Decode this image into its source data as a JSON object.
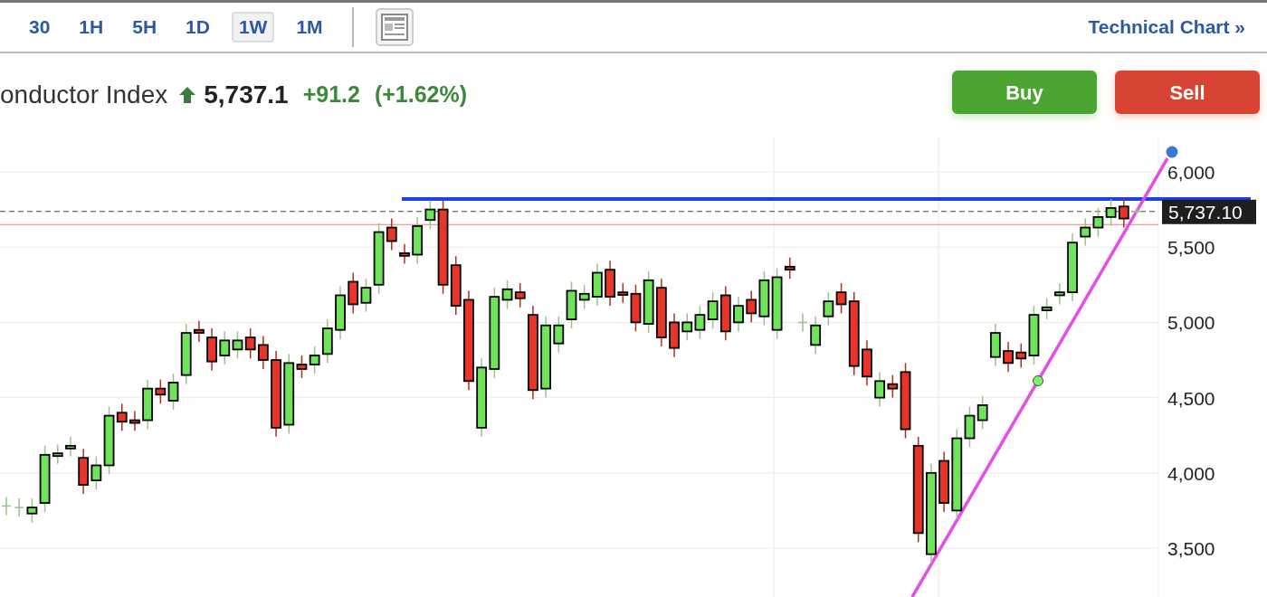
{
  "timeframes": [
    {
      "label": "30",
      "selected": false
    },
    {
      "label": "1H",
      "selected": false
    },
    {
      "label": "5H",
      "selected": false
    },
    {
      "label": "1D",
      "selected": false
    },
    {
      "label": "1W",
      "selected": true
    },
    {
      "label": "1M",
      "selected": false
    }
  ],
  "technical_link": {
    "label": "Technical Chart",
    "chevron": "»"
  },
  "quote": {
    "name": "onductor Index",
    "price": "5,737.1",
    "change": "+91.2",
    "change_pct": "(+1.62%)"
  },
  "buttons": [
    {
      "kind": "buy",
      "label": "Buy"
    },
    {
      "kind": "sell",
      "label": "Sell"
    }
  ],
  "chart": {
    "current_price": "5,737.10",
    "chart_data": {
      "type": "candlestick",
      "grid": true,
      "ylim": [
        3500,
        6000
      ],
      "ohlc": [
        [
          3780,
          3840,
          3720,
          3780
        ],
        [
          3770,
          3830,
          3710,
          3770
        ],
        [
          3730,
          3830,
          3670,
          3770
        ],
        [
          3800,
          4180,
          3740,
          4120
        ],
        [
          4120,
          4190,
          4060,
          4130
        ],
        [
          4170,
          4240,
          4110,
          4180
        ],
        [
          4100,
          4160,
          3860,
          3920
        ],
        [
          3950,
          4110,
          3890,
          4050
        ],
        [
          4050,
          4440,
          3990,
          4380
        ],
        [
          4400,
          4460,
          4280,
          4340
        ],
        [
          4350,
          4410,
          4280,
          4340
        ],
        [
          4350,
          4620,
          4290,
          4560
        ],
        [
          4560,
          4620,
          4460,
          4520
        ],
        [
          4480,
          4660,
          4420,
          4600
        ],
        [
          4650,
          4990,
          4590,
          4930
        ],
        [
          4950,
          5010,
          4870,
          4930
        ],
        [
          4900,
          4960,
          4680,
          4740
        ],
        [
          4780,
          4940,
          4720,
          4880
        ],
        [
          4820,
          4940,
          4760,
          4880
        ],
        [
          4900,
          4960,
          4760,
          4820
        ],
        [
          4850,
          4910,
          4690,
          4750
        ],
        [
          4750,
          4810,
          4240,
          4300
        ],
        [
          4320,
          4790,
          4260,
          4730
        ],
        [
          4720,
          4780,
          4630,
          4690
        ],
        [
          4720,
          4840,
          4660,
          4780
        ],
        [
          4790,
          5020,
          4730,
          4960
        ],
        [
          4950,
          5240,
          4890,
          5180
        ],
        [
          5270,
          5330,
          5060,
          5120
        ],
        [
          5130,
          5290,
          5070,
          5230
        ],
        [
          5250,
          5660,
          5190,
          5600
        ],
        [
          5630,
          5690,
          5480,
          5540
        ],
        [
          5460,
          5520,
          5390,
          5450
        ],
        [
          5450,
          5700,
          5390,
          5640
        ],
        [
          5680,
          5810,
          5620,
          5750
        ],
        [
          5750,
          5810,
          5190,
          5250
        ],
        [
          5380,
          5440,
          5050,
          5110
        ],
        [
          5150,
          5210,
          4550,
          4610
        ],
        [
          4300,
          4760,
          4240,
          4700
        ],
        [
          4690,
          5230,
          4630,
          5170
        ],
        [
          5150,
          5280,
          5090,
          5220
        ],
        [
          5200,
          5260,
          5100,
          5160
        ],
        [
          5050,
          5110,
          4490,
          4550
        ],
        [
          4560,
          5040,
          4500,
          4980
        ],
        [
          4860,
          5040,
          4800,
          4980
        ],
        [
          5020,
          5270,
          4960,
          5210
        ],
        [
          5150,
          5250,
          5090,
          5190
        ],
        [
          5170,
          5390,
          5110,
          5330
        ],
        [
          5350,
          5410,
          5110,
          5170
        ],
        [
          5200,
          5260,
          5130,
          5190
        ],
        [
          5190,
          5250,
          4940,
          5000
        ],
        [
          4990,
          5340,
          4930,
          5280
        ],
        [
          5230,
          5290,
          4840,
          4900
        ],
        [
          5000,
          5060,
          4770,
          4830
        ],
        [
          4940,
          5060,
          4880,
          5000
        ],
        [
          4950,
          5110,
          4890,
          5050
        ],
        [
          5020,
          5200,
          4960,
          5140
        ],
        [
          5180,
          5240,
          4880,
          4940
        ],
        [
          5000,
          5170,
          4940,
          5110
        ],
        [
          5150,
          5210,
          5000,
          5060
        ],
        [
          5040,
          5340,
          4980,
          5280
        ],
        [
          4950,
          5360,
          4890,
          5300
        ],
        [
          5370,
          5430,
          5290,
          5350
        ],
        [
          5000,
          5060,
          4940,
          5000
        ],
        [
          4850,
          5040,
          4790,
          4980
        ],
        [
          5040,
          5200,
          4980,
          5140
        ],
        [
          5200,
          5260,
          5060,
          5120
        ],
        [
          5140,
          5200,
          4650,
          4710
        ],
        [
          4820,
          4880,
          4580,
          4640
        ],
        [
          4500,
          4670,
          4440,
          4610
        ],
        [
          4590,
          4650,
          4500,
          4560
        ],
        [
          4670,
          4730,
          4230,
          4290
        ],
        [
          4180,
          4240,
          3540,
          3600
        ],
        [
          3460,
          4060,
          3400,
          4000
        ],
        [
          4080,
          4140,
          3740,
          3800
        ],
        [
          3750,
          4290,
          3690,
          4230
        ],
        [
          4230,
          4440,
          4170,
          4380
        ],
        [
          4350,
          4510,
          4290,
          4450
        ],
        [
          4770,
          4990,
          4710,
          4930
        ],
        [
          4810,
          4870,
          4670,
          4730
        ],
        [
          4800,
          4860,
          4700,
          4760
        ],
        [
          4780,
          5110,
          4720,
          5050
        ],
        [
          5080,
          5160,
          5020,
          5100
        ],
        [
          5180,
          5260,
          5120,
          5200
        ],
        [
          5200,
          5590,
          5140,
          5530
        ],
        [
          5570,
          5690,
          5510,
          5630
        ],
        [
          5630,
          5760,
          5570,
          5700
        ],
        [
          5700,
          5820,
          5640,
          5760
        ],
        [
          5770,
          5830,
          5630,
          5690
        ],
        [
          5737,
          5760,
          5720,
          5737
        ]
      ],
      "yticks": [
        {
          "value": 6000,
          "label": "6,000"
        },
        {
          "value": 5500,
          "label": "5,500"
        },
        {
          "value": 5000,
          "label": "5,000"
        },
        {
          "value": 4500,
          "label": "4,500"
        },
        {
          "value": 4000,
          "label": "4,000"
        },
        {
          "value": 3500,
          "label": "3,500"
        }
      ]
    }
  }
}
